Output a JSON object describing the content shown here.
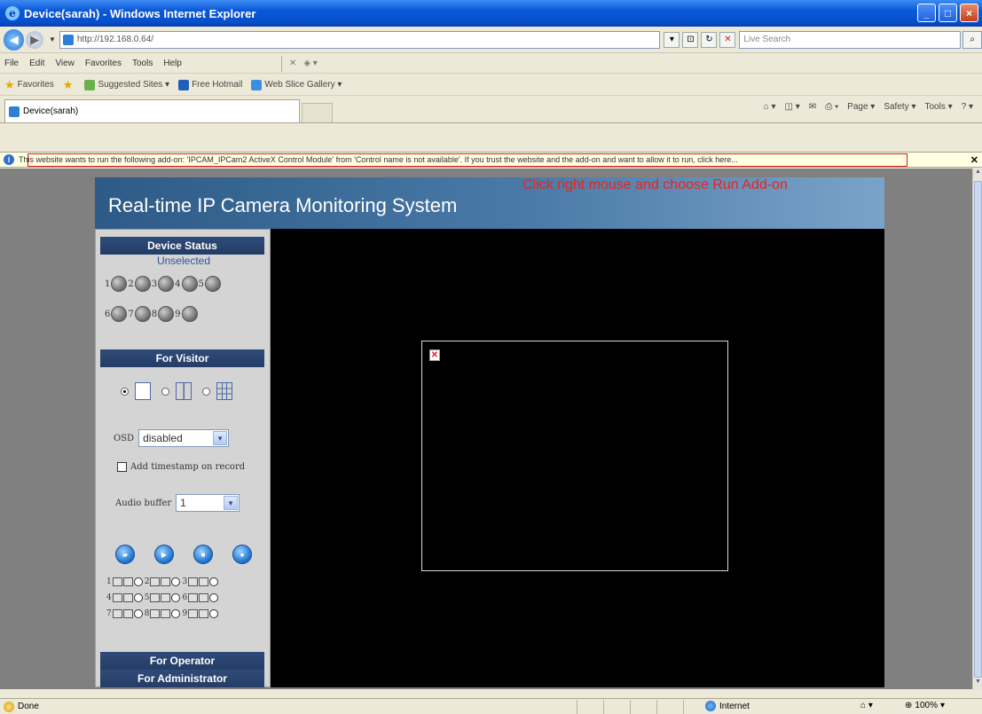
{
  "window": {
    "title": "Device(sarah) - Windows Internet Explorer",
    "min": "_",
    "max": "□",
    "close": "×"
  },
  "address": {
    "url": "http://192.168.0.64/",
    "search_placeholder": "Live Search"
  },
  "menu": [
    "File",
    "Edit",
    "View",
    "Favorites",
    "Tools",
    "Help"
  ],
  "favorites": {
    "label": "Favorites",
    "items": [
      "Suggested Sites ▾",
      "Free Hotmail",
      "Web Slice Gallery ▾"
    ]
  },
  "tab": {
    "label": "Device(sarah)"
  },
  "commandbar": [
    "Page ▾",
    "Safety ▾",
    "Tools ▾"
  ],
  "infobar": {
    "text": "This website wants to run the following add-on: 'IPCAM_IPCam2 ActiveX Control Module' from 'Control name is not available'. If you trust the website and the add-on and want to allow it to run, click here..."
  },
  "page": {
    "banner_title": "Real-time IP Camera Monitoring System",
    "annotation": "Click right mouse and choose Run Add-on",
    "device_status": {
      "heading": "Device Status",
      "state": "Unselected",
      "cameras": [
        "1",
        "2",
        "3",
        "4",
        "5",
        "6",
        "7",
        "8",
        "9"
      ]
    },
    "visitor": {
      "heading": "For Visitor",
      "osd_label": "OSD",
      "osd_value": "disabled",
      "timestamp_label": "Add timestamp on record",
      "audio_label": "Audio buffer",
      "audio_value": "1",
      "cam_controls": [
        "1",
        "2",
        "3",
        "4",
        "5",
        "6",
        "7",
        "8",
        "9"
      ]
    },
    "operator_heading": "For Operator",
    "admin_heading": "For Administrator"
  },
  "status": {
    "left": "Done",
    "zone": "Internet",
    "zoom": "100%"
  }
}
